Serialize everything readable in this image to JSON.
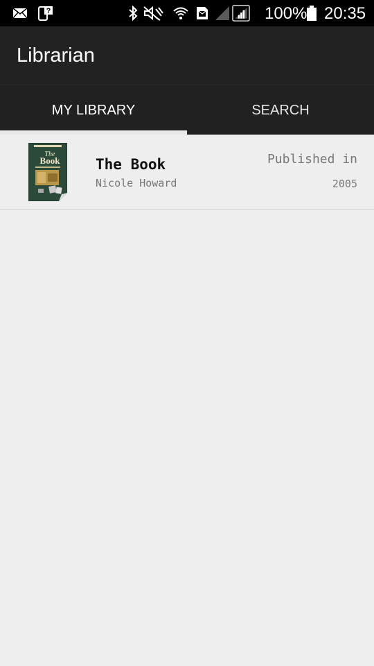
{
  "status_bar": {
    "battery": "100%",
    "time": "20:35",
    "icons": [
      "mail-icon",
      "phone-question-icon",
      "bluetooth-icon",
      "mute-icon",
      "wifi-icon",
      "sim-icon",
      "signal-empty-icon",
      "signal-icon",
      "battery-icon"
    ]
  },
  "app_bar": {
    "title": "Librarian"
  },
  "tabs": [
    {
      "label": "MY LIBRARY",
      "selected": true
    },
    {
      "label": "SEARCH",
      "selected": false
    }
  ],
  "books": [
    {
      "title": "The Book",
      "author": "Nicole Howard",
      "published_label": "Published in",
      "year": "2005",
      "cover_icon": "book-cover-thumbnail"
    }
  ],
  "colors": {
    "status_bar_bg": "#000000",
    "app_bar_bg": "#222222",
    "tab_bar_bg": "#212121",
    "tab_indicator": "#e8e8e8",
    "content_bg": "#eeeeee"
  }
}
